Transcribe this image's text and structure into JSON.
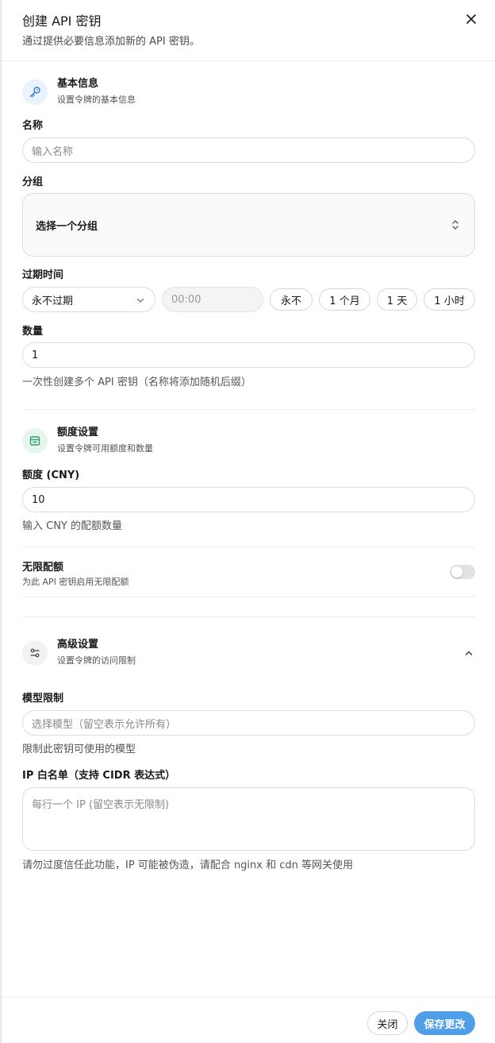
{
  "dialog": {
    "title": "创建 API 密钥",
    "subtitle": "通过提供必要信息添加新的 API 密钥。"
  },
  "basic": {
    "title": "基本信息",
    "subtitle": "设置令牌的基本信息",
    "name_label": "名称",
    "name_placeholder": "输入名称",
    "group_label": "分组",
    "group_value": "选择一个分组",
    "expiry_label": "过期时间",
    "expiry_value": "永不过期",
    "time_placeholder": "00:00",
    "presets": [
      "永不",
      "1 个月",
      "1 天",
      "1 小时"
    ],
    "count_label": "数量",
    "count_value": "1",
    "count_help": "一次性创建多个 API 密钥（名称将添加随机后缀）"
  },
  "quota": {
    "title": "额度设置",
    "subtitle": "设置令牌可用额度和数量",
    "amount_label": "额度 (CNY)",
    "amount_value": "10",
    "amount_help": "输入 CNY 的配额数量",
    "unlimited_title": "无限配额",
    "unlimited_sub": "为此 API 密钥启用无限配额",
    "unlimited_on": false
  },
  "advanced": {
    "title": "高级设置",
    "subtitle": "设置令牌的访问限制",
    "model_label": "模型限制",
    "model_placeholder": "选择模型（留空表示允许所有）",
    "model_help": "限制此密钥可使用的模型",
    "ip_label": "IP 白名单（支持 CIDR 表达式）",
    "ip_placeholder": "每行一个 IP (留空表示无限制)",
    "ip_help": "请勿过度信任此功能，IP 可能被伪造，请配合 nginx 和 cdn 等网关使用"
  },
  "footer": {
    "close_label": "关闭",
    "save_label": "保存更改"
  },
  "colors": {
    "primary": "#4f9ee8",
    "key_icon": "#2f7fd8",
    "quota_icon": "#2f9e6a"
  }
}
